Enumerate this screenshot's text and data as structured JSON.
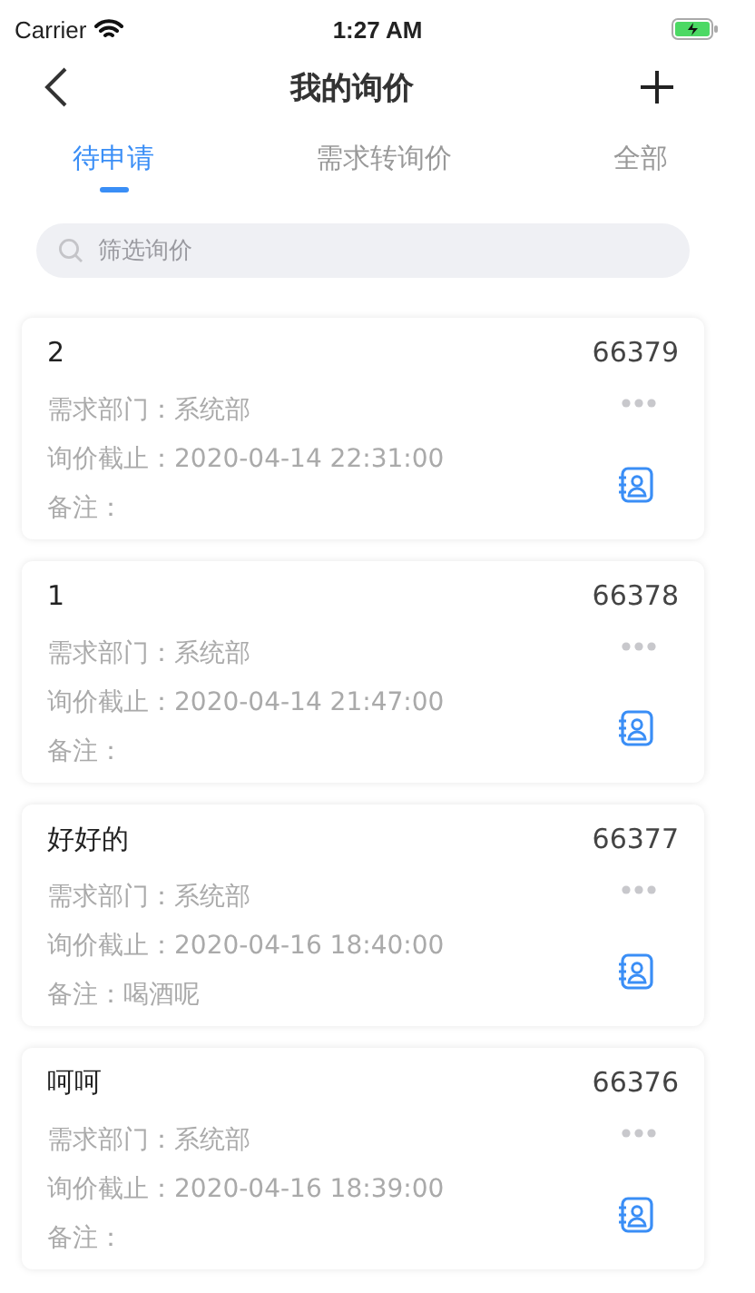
{
  "status_bar": {
    "carrier": "Carrier",
    "time": "1:27 AM"
  },
  "nav": {
    "title": "我的询价"
  },
  "tabs": [
    {
      "label": "待申请",
      "selected": true
    },
    {
      "label": "需求转询价",
      "selected": false
    },
    {
      "label": "全部",
      "selected": false
    }
  ],
  "search": {
    "placeholder": "筛选询价"
  },
  "cards": [
    {
      "title": "2",
      "number": "66379",
      "lines": [
        "需求部门：系统部",
        "询价截止：2020-04-14 22:31:00",
        "备注："
      ]
    },
    {
      "title": "1",
      "number": "66378",
      "lines": [
        "需求部门：系统部",
        "询价截止：2020-04-14 21:47:00",
        "备注："
      ]
    },
    {
      "title": "好好的",
      "number": "66377",
      "lines": [
        "需求部门：系统部",
        "询价截止：2020-04-16 18:40:00",
        "备注：喝酒呢"
      ]
    },
    {
      "title": "呵呵",
      "number": "66376",
      "lines": [
        "需求部门：系统部",
        "询价截止：2020-04-16 18:39:00",
        "备注："
      ]
    }
  ]
}
